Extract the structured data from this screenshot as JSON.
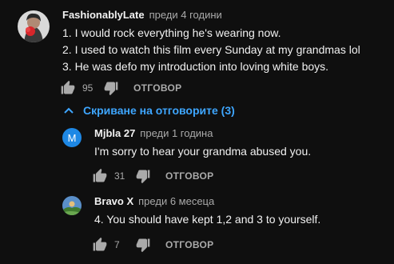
{
  "comment": {
    "author": "FashionablyLate",
    "time": "преди 4 години",
    "lines": [
      "1. I would rock everything he's wearing now.",
      "2. I used to watch this film every Sunday at my grandmas lol",
      "3. He was defo my introduction into loving white boys."
    ],
    "likes": "95",
    "reply_label": "ОТГОВОР"
  },
  "replies_toggle": {
    "label": "Скриване на отговорите (3)"
  },
  "replies": [
    {
      "author": "Mjbla 27",
      "time": "преди 1 година",
      "avatar_letter": "M",
      "avatar_color": "#1e88e5",
      "text": "I'm sorry to hear your grandma abused you.",
      "likes": "31",
      "reply_label": "ОТГОВОР"
    },
    {
      "author": "Bravo X",
      "time": "преди 6 месеца",
      "text": "4. You should have kept 1,2 and 3 to yourself.",
      "likes": "7",
      "reply_label": "ОТГОВОР"
    }
  ]
}
